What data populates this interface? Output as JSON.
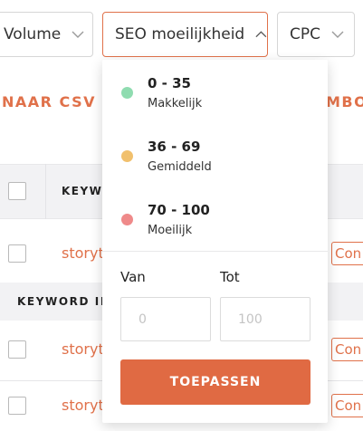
{
  "filters": {
    "volume": "Volume",
    "seo": "SEO moeilijkheid",
    "cpc": "CPC"
  },
  "actions": {
    "csv_export": "NAAR CSV EX",
    "right_partial": "MBO"
  },
  "table": {
    "header_keyword": "KEYWO",
    "group_label": "KEYWORD ID",
    "rows": [
      "storyte",
      "storyte",
      "storyte"
    ],
    "action_label": "Con"
  },
  "dropdown": {
    "options": [
      {
        "range": "0 - 35",
        "label": "Makkelijk",
        "color": "#8fdcb0"
      },
      {
        "range": "36 - 69",
        "label": "Gemiddeld",
        "color": "#f1c06d"
      },
      {
        "range": "70 - 100",
        "label": "Moeilijk",
        "color": "#ef8a8a"
      }
    ],
    "from_label": "Van",
    "to_label": "Tot",
    "from_placeholder": "0",
    "to_placeholder": "100",
    "apply_label": "TOEPASSEN"
  },
  "colors": {
    "accent": "#e0714a"
  }
}
